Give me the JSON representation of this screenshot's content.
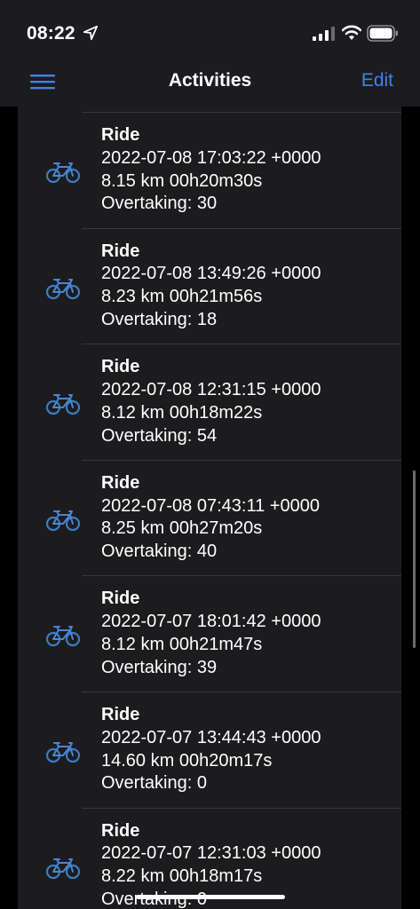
{
  "status_bar": {
    "time": "08:22"
  },
  "nav": {
    "title": "Activities",
    "edit_label": "Edit"
  },
  "activities": [
    {
      "title": "Ride",
      "datetime": "2022-07-08 17:03:22 +0000",
      "summary": "8.15 km 00h20m30s",
      "overtaking": "Overtaking: 30"
    },
    {
      "title": "Ride",
      "datetime": "2022-07-08 13:49:26 +0000",
      "summary": "8.23 km 00h21m56s",
      "overtaking": "Overtaking: 18"
    },
    {
      "title": "Ride",
      "datetime": "2022-07-08 12:31:15 +0000",
      "summary": "8.12 km 00h18m22s",
      "overtaking": "Overtaking: 54"
    },
    {
      "title": "Ride",
      "datetime": "2022-07-08 07:43:11 +0000",
      "summary": "8.25 km 00h27m20s",
      "overtaking": "Overtaking: 40"
    },
    {
      "title": "Ride",
      "datetime": "2022-07-07 18:01:42 +0000",
      "summary": "8.12 km 00h21m47s",
      "overtaking": "Overtaking: 39"
    },
    {
      "title": "Ride",
      "datetime": "2022-07-07 13:44:43 +0000",
      "summary": "14.60 km 00h20m17s",
      "overtaking": "Overtaking: 0"
    },
    {
      "title": "Ride",
      "datetime": "2022-07-07 12:31:03 +0000",
      "summary": "8.22 km 00h18m17s",
      "overtaking": "Overtaking: 0"
    }
  ],
  "icons": {
    "row_icon": "bicycle-icon",
    "menu": "hamburger-menu-icon"
  },
  "colors": {
    "accent": "#3e84e6",
    "background": "#1c1c1e"
  }
}
